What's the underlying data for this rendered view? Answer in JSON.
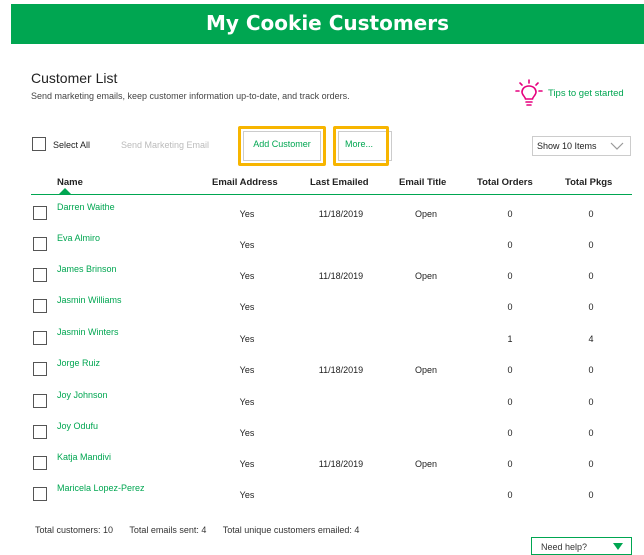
{
  "header": {
    "title": "My Cookie Customers"
  },
  "section": {
    "title": "Customer List",
    "subtitle": "Send marketing emails, keep customer information up-to-date, and track orders.",
    "tips_label": "Tips to get started"
  },
  "toolbar": {
    "select_all": "Select All",
    "send_email": "Send Marketing Email",
    "add_customer": "Add Customer",
    "more": "More...",
    "show_items": "Show 10 Items"
  },
  "table": {
    "columns": [
      "Name",
      "Email Address",
      "Last Emailed",
      "Email Title",
      "Total Orders",
      "Total Pkgs"
    ],
    "rows": [
      {
        "name": "Darren Waithe",
        "email": "Yes",
        "last_emailed": "11/18/2019",
        "title": "Open",
        "orders": "0",
        "pkgs": "0"
      },
      {
        "name": "Eva Almiro",
        "email": "Yes",
        "last_emailed": "",
        "title": "",
        "orders": "0",
        "pkgs": "0"
      },
      {
        "name": "James Brinson",
        "email": "Yes",
        "last_emailed": "11/18/2019",
        "title": "Open",
        "orders": "0",
        "pkgs": "0"
      },
      {
        "name": "Jasmin Williams",
        "email": "Yes",
        "last_emailed": "",
        "title": "",
        "orders": "0",
        "pkgs": "0"
      },
      {
        "name": "Jasmin Winters",
        "email": "Yes",
        "last_emailed": "",
        "title": "",
        "orders": "1",
        "pkgs": "4"
      },
      {
        "name": "Jorge Ruiz",
        "email": "Yes",
        "last_emailed": "11/18/2019",
        "title": "Open",
        "orders": "0",
        "pkgs": "0"
      },
      {
        "name": "Joy Johnson",
        "email": "Yes",
        "last_emailed": "",
        "title": "",
        "orders": "0",
        "pkgs": "0"
      },
      {
        "name": "Joy Odufu",
        "email": "Yes",
        "last_emailed": "",
        "title": "",
        "orders": "0",
        "pkgs": "0"
      },
      {
        "name": "Katja Mandivi",
        "email": "Yes",
        "last_emailed": "11/18/2019",
        "title": "Open",
        "orders": "0",
        "pkgs": "0"
      },
      {
        "name": "Maricela Lopez-Perez",
        "email": "Yes",
        "last_emailed": "",
        "title": "",
        "orders": "0",
        "pkgs": "0"
      }
    ]
  },
  "footer": {
    "total_customers": "Total customers: 10",
    "total_emails": "Total emails sent: 4",
    "total_unique": "Total unique customers emailed: 4"
  },
  "help": {
    "label": "Need help?"
  },
  "colors": {
    "brand": "#00a651",
    "highlight": "#f7b500",
    "tips_icon": "#e6007e"
  },
  "icons": [
    "lightbulb-icon",
    "chevron-down-icon",
    "sort-caret-icon",
    "triangle-down-icon"
  ]
}
